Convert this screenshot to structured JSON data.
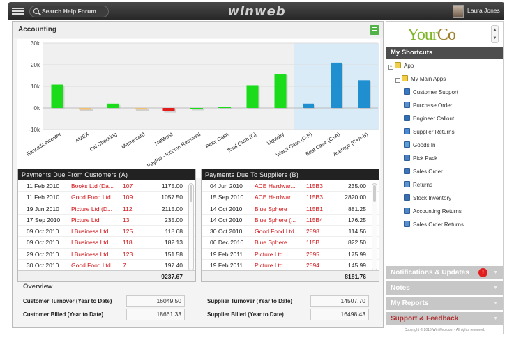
{
  "topbar": {
    "search_label": "Search Help Forum",
    "brand": "winweb",
    "user_name": "Laura Jones"
  },
  "accounting": {
    "title": "Accounting"
  },
  "chart_data": {
    "type": "bar",
    "categories": [
      "Alliance&Leicester",
      "AMEX",
      "Citi Checking",
      "Mastercard",
      "NatWest",
      "PayPal - Income Received",
      "Petty Cash",
      "Total Cash (C)",
      "Liquidity",
      "Worst Case (C-B)",
      "Best Case (C+A)",
      "Average (C+A-B)"
    ],
    "tick_labels": [
      "lliance&Leicester",
      "AMEX",
      "Citi Checking",
      "Mastercard",
      "NatWest",
      "PayPal - Income Received",
      "Petty Cash",
      "Total Cash (C)",
      "Liquidity",
      "Worst Case (C-B)",
      "Best Case (C+A)",
      "Average (C+A-B)"
    ],
    "values": [
      10800,
      -800,
      2000,
      -700,
      -1500,
      0,
      600,
      10500,
      15800,
      2000,
      21000,
      12800
    ],
    "bar_colors": [
      "#1bdc1b",
      "#f0c070",
      "#1bdc1b",
      "#f0c070",
      "#e01c1c",
      "#1bdc1b",
      "#1bdc1b",
      "#1bdc1b",
      "#1bdc1b",
      "#1f8fd0",
      "#1f8fd0",
      "#1f8fd0"
    ],
    "highlight_from": 9,
    "yticks": [
      "30k",
      "20k",
      "10k",
      "0k",
      "-10k"
    ],
    "ylim": [
      -10000,
      30000
    ]
  },
  "customers": {
    "title": "Payments Due From Customers (A)",
    "rows": [
      {
        "date": "11 Feb 2010",
        "name": "Books Ltd (Da...",
        "ref": "107",
        "amount": "1175.00"
      },
      {
        "date": "11 Feb 2010",
        "name": "Good Food Ltd...",
        "ref": "109",
        "amount": "1057.50"
      },
      {
        "date": "19 Jun 2010",
        "name": "Picture Ltd (D...",
        "ref": "112",
        "amount": "2115.00"
      },
      {
        "date": "17 Sep 2010",
        "name": "Picture Ltd",
        "ref": "13",
        "amount": "235.00"
      },
      {
        "date": "09 Oct 2010",
        "name": "I Business Ltd",
        "ref": "125",
        "amount": "118.68"
      },
      {
        "date": "09 Oct 2010",
        "name": "I Business Ltd",
        "ref": "118",
        "amount": "182.13"
      },
      {
        "date": "29 Oct 2010",
        "name": "I Business Ltd",
        "ref": "123",
        "amount": "151.58"
      },
      {
        "date": "30 Oct 2010",
        "name": "Good Food Ltd",
        "ref": "7",
        "amount": "197.40"
      }
    ],
    "total": "9237.67"
  },
  "suppliers": {
    "title": "Payments Due To Suppliers (B)",
    "rows": [
      {
        "date": "04 Jun 2010",
        "name": "ACE Hardwar...",
        "ref": "115B3",
        "amount": "235.00"
      },
      {
        "date": "15 Sep 2010",
        "name": "ACE Hardwar...",
        "ref": "115B3",
        "amount": "2820.00"
      },
      {
        "date": "14 Oct 2010",
        "name": "Blue Sphere",
        "ref": "115B1",
        "amount": "881.25"
      },
      {
        "date": "14 Oct 2010",
        "name": "Blue Sphere (...",
        "ref": "115B4",
        "amount": "176.25"
      },
      {
        "date": "30 Oct 2010",
        "name": "Good Food Ltd",
        "ref": "2898",
        "amount": "114.56"
      },
      {
        "date": "06 Dec 2010",
        "name": "Blue Sphere",
        "ref": "115B",
        "amount": "822.50"
      },
      {
        "date": "19 Feb 2011",
        "name": "Picture Ltd",
        "ref": "2595",
        "amount": "175.99"
      },
      {
        "date": "19 Feb 2011",
        "name": "Picture Ltd",
        "ref": "2594",
        "amount": "145.99"
      }
    ],
    "total": "8181.76"
  },
  "overview": {
    "title": "Overview",
    "customer_turnover_label": "Customer Turnover (Year to Date)",
    "customer_turnover": "16049.50",
    "customer_billed_label": "Customer Billed (Year to Date)",
    "customer_billed": "18661.33",
    "supplier_turnover_label": "Supplier Turnover (Year to Date)",
    "supplier_turnover": "14507.70",
    "supplier_billed_label": "Supplier Billed (Year to Date)",
    "supplier_billed": "16498.43"
  },
  "sidebar": {
    "logo_main": "Your",
    "logo_co": "Co",
    "shortcuts_title": "My Shortcuts",
    "tree_root": "App",
    "tree_folder": "My Main Apps",
    "items": [
      "Customer Support",
      "Purchase Order",
      "Engineer Callout",
      "Supplier Returns",
      "Goods In",
      "Pick Pack",
      "Sales Order",
      "Returns",
      "Stock Inventory",
      "Accounting Returns",
      "Sales Order Returns"
    ],
    "sections": [
      "Notifications & Updates",
      "Notes",
      "My Reports",
      "Support & Feedback"
    ],
    "alert_mark": "!",
    "copyright": "Copyright © 2016 WinWeb.com - All rights reserved."
  }
}
